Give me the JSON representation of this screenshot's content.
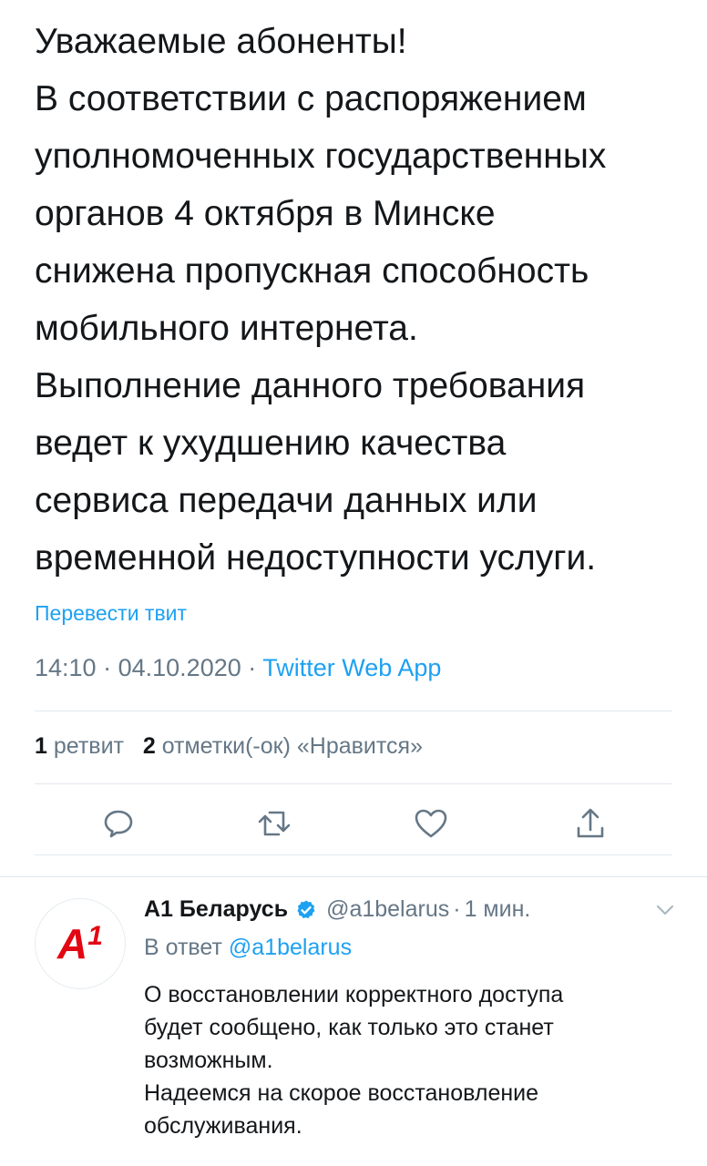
{
  "tweet": {
    "lines": [
      "Уважаемые абоненты!",
      "В соответствии с распоряжением",
      "уполномоченных государственных",
      "органов 4 октября в Минске",
      "снижена пропускная способность",
      "мобильного интернета.",
      "Выполнение данного требования",
      "ведет к ухудшению качества",
      "сервиса передачи данных или",
      "временной недоступности услуги."
    ],
    "translate_label": "Перевести твит",
    "time": "14:10",
    "separator": "·",
    "date": "04.10.2020",
    "source": "Twitter Web App"
  },
  "stats": {
    "retweets_count": "1",
    "retweets_label": "ретвит",
    "likes_count": "2",
    "likes_label": "отметки(-ок) «Нравится»"
  },
  "actions": {
    "reply_icon": "reply-icon",
    "retweet_icon": "retweet-icon",
    "like_icon": "heart-icon",
    "share_icon": "share-icon"
  },
  "reply": {
    "avatar_logo": "A1",
    "name": "А1 Беларусь",
    "handle": "@a1belarus",
    "dot": "·",
    "time": "1 мин.",
    "reply_prefix": "В ответ",
    "reply_mention": "@a1belarus",
    "lines": [
      "О восстановлении корректного доступа",
      "будет сообщено, как только это станет",
      "возможным.",
      "Надеемся на скорое восстановление",
      "обслуживания."
    ]
  },
  "colors": {
    "accent": "#1da1f2",
    "muted": "#657786",
    "text": "#14171a",
    "brand_red": "#e30613"
  }
}
